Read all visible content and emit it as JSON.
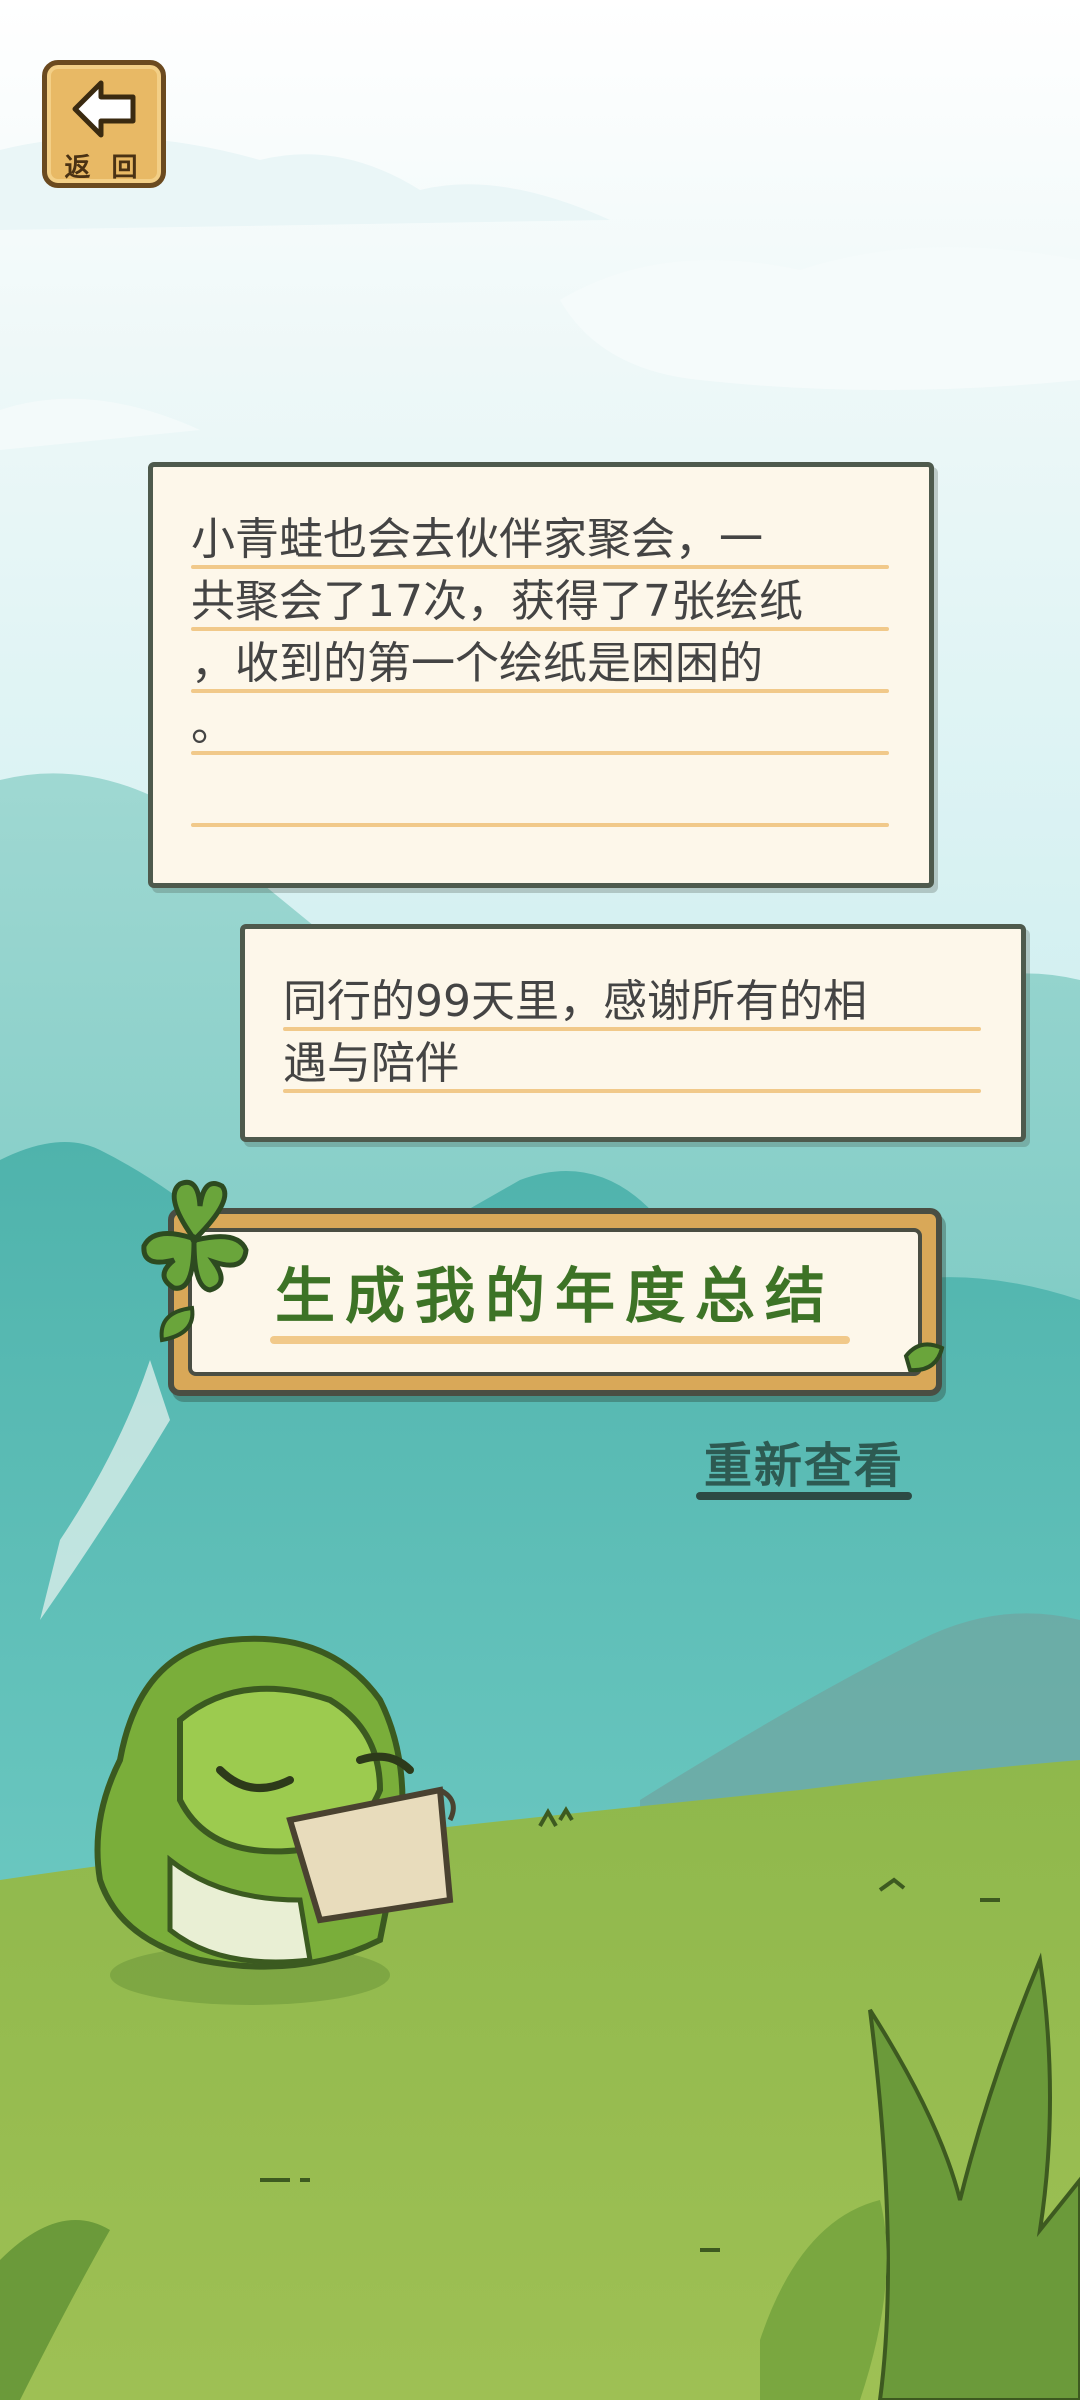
{
  "nav": {
    "back_label": "返 回"
  },
  "notes": [
    {
      "lines": [
        "小青蛙也会去伙伴家聚会，一",
        "共聚会了17次，获得了7张绘纸",
        "，收到的第一个绘纸是困困的",
        "。"
      ]
    },
    {
      "lines": [
        "同行的99天里，感谢所有的相",
        "遇与陪伴"
      ]
    }
  ],
  "actions": {
    "generate_label": "生成我的年度总结",
    "replay_label": "重新查看"
  },
  "colors": {
    "sky": "#d4eff2",
    "mountain": "#5cbdb6",
    "grass": "#8fb84d",
    "frog": "#8ec04a",
    "paper": "#fdf7ea",
    "accent_text": "#3d7326"
  },
  "icons": [
    "back-arrow-icon",
    "clover-icon",
    "leaf-icon",
    "frog-character",
    "scroll-icon"
  ]
}
